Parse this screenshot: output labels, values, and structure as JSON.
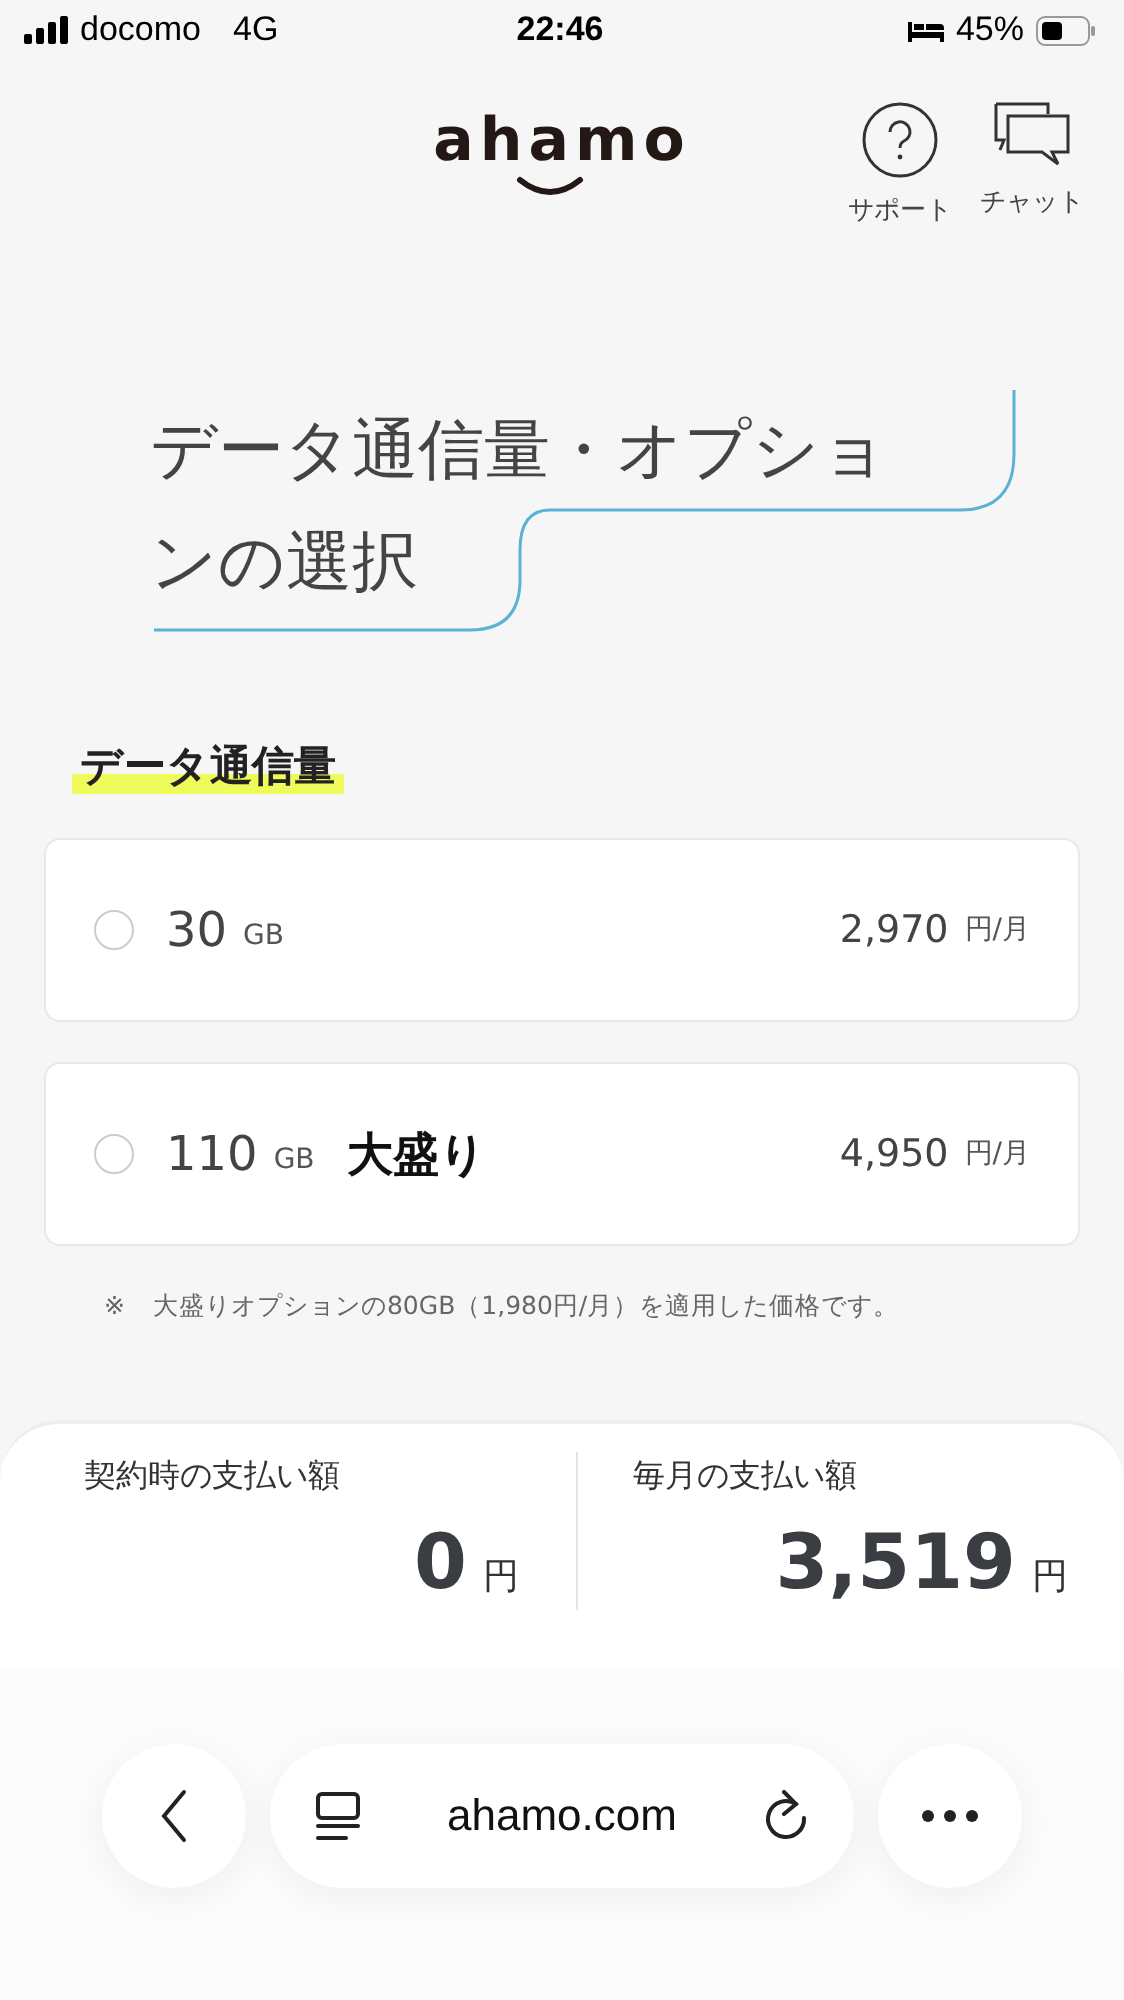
{
  "status_bar": {
    "carrier": "docomo",
    "network": "4G",
    "time": "22:46",
    "battery": "45%"
  },
  "header": {
    "logo": "ahamo",
    "actions": [
      {
        "kind": "support",
        "label": "サポート"
      },
      {
        "kind": "chat",
        "label": "チャット"
      }
    ]
  },
  "page_title": {
    "lines": [
      "データ通信量・オプショ",
      "ンの選択"
    ]
  },
  "section": {
    "heading": "データ通信量",
    "plans": [
      {
        "amount": "30",
        "unit": "GB",
        "price": "2,970",
        "price_unit": "円/月",
        "selected": false
      },
      {
        "amount": "110",
        "unit": "GB",
        "badge": "大盛り",
        "price": "4,950",
        "price_unit": "円/月",
        "selected": false
      }
    ],
    "note_mark": "※",
    "note": "大盛りオプションの80GB（1,980円/月）を適用した価格です。"
  },
  "summary": [
    {
      "label": "契約時の支払い額",
      "amount": "0",
      "unit": "円"
    },
    {
      "label": "毎月の支払い額",
      "amount": "3,519",
      "unit": "円"
    }
  ],
  "browser": {
    "url": "ahamo.com"
  }
}
